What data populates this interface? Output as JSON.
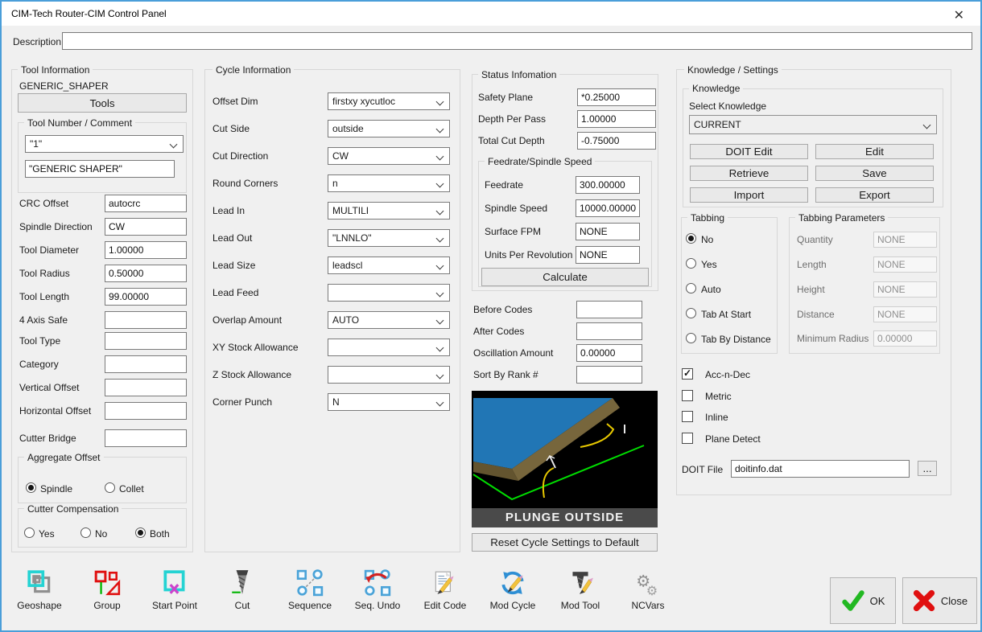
{
  "window": {
    "title": "CIM-Tech Router-CIM Control Panel",
    "close_glyph": "✕"
  },
  "description": {
    "label": "Description",
    "value": ""
  },
  "colors": {
    "accent_border": "#4a9ed9",
    "caption_bar": "#4a4a4a",
    "preview_top": "#2176b5",
    "preview_edge": "#77663c",
    "preview_outline": "#00dd00",
    "preview_path": "#e6c700",
    "ok_check": "#22b822",
    "close_x": "#e01010"
  },
  "tool": {
    "group_title": "Tool Information",
    "tool_name": "GENERIC_SHAPER",
    "tools_button": "Tools",
    "tool_number_group": "Tool Number / Comment",
    "tool_number": "\"1\"",
    "tool_comment": "\"GENERIC SHAPER\"",
    "rows": [
      {
        "label": "CRC Offset",
        "value": "autocrc"
      },
      {
        "label": "Spindle Direction",
        "value": "CW"
      },
      {
        "label": "Tool Diameter",
        "value": "1.00000"
      },
      {
        "label": "Tool Radius",
        "value": "0.50000"
      },
      {
        "label": "Tool Length",
        "value": "99.00000"
      },
      {
        "label": "4 Axis Safe",
        "value": ""
      },
      {
        "label": "Tool Type",
        "value": ""
      },
      {
        "label": "Category",
        "value": ""
      },
      {
        "label": "Vertical Offset",
        "value": ""
      },
      {
        "label": "Horizontal Offset",
        "value": ""
      },
      {
        "label": "Cutter Bridge",
        "value": ""
      }
    ],
    "aggregate_offset": {
      "title": "Aggregate Offset",
      "options": [
        {
          "label": "Spindle",
          "selected": true
        },
        {
          "label": "Collet",
          "selected": false
        }
      ]
    },
    "cutter_compensation": {
      "title": "Cutter Compensation",
      "options": [
        {
          "label": "Yes",
          "selected": false
        },
        {
          "label": "No",
          "selected": false
        },
        {
          "label": "Both",
          "selected": true
        }
      ]
    }
  },
  "cycle": {
    "group_title": "Cycle Information",
    "rows": [
      {
        "label": "Offset Dim",
        "value": "firstxy xycutloc"
      },
      {
        "label": "Cut Side",
        "value": "outside"
      },
      {
        "label": "Cut Direction",
        "value": "CW"
      },
      {
        "label": "Round Corners",
        "value": "n"
      },
      {
        "label": "Lead In",
        "value": "MULTILI"
      },
      {
        "label": "Lead Out",
        "value": "\"LNNLO\""
      },
      {
        "label": "Lead Size",
        "value": "leadscl"
      },
      {
        "label": "Lead Feed",
        "value": ""
      },
      {
        "label": "Overlap Amount",
        "value": "AUTO"
      },
      {
        "label": "XY Stock Allowance",
        "value": ""
      },
      {
        "label": "Z Stock Allowance",
        "value": ""
      },
      {
        "label": "Corner Punch",
        "value": "N"
      }
    ]
  },
  "status": {
    "group_title": "Status Infomation",
    "rows": [
      {
        "label": "Safety Plane",
        "value": "*0.25000"
      },
      {
        "label": "Depth Per Pass",
        "value": "1.00000"
      },
      {
        "label": "Total Cut Depth",
        "value": "-0.75000"
      }
    ],
    "feed": {
      "title": "Feedrate/Spindle Speed",
      "rows": [
        {
          "label": "Feedrate",
          "value": "300.00000"
        },
        {
          "label": "Spindle Speed",
          "value": "10000.00000"
        },
        {
          "label": "Surface FPM",
          "value": "NONE"
        },
        {
          "label": "Units Per Revolution",
          "value": "NONE"
        }
      ],
      "calculate_button": "Calculate"
    },
    "extra": [
      {
        "label": "Before Codes",
        "value": ""
      },
      {
        "label": "After Codes",
        "value": ""
      },
      {
        "label": "Oscillation Amount",
        "value": "0.00000"
      },
      {
        "label": "Sort By Rank #",
        "value": ""
      }
    ],
    "preview_caption": "PLUNGE OUTSIDE",
    "reset_button": "Reset Cycle Settings to Default"
  },
  "knowledge": {
    "group_title": "Knowledge / Settings",
    "inner_title": "Knowledge",
    "select_label": "Select Knowledge",
    "select_value": "CURRENT",
    "buttons": [
      "DOIT Edit",
      "Edit",
      "Retrieve",
      "Save",
      "Import",
      "Export"
    ],
    "tabbing": {
      "title": "Tabbing",
      "options": [
        {
          "label": "No",
          "selected": true
        },
        {
          "label": "Yes",
          "selected": false
        },
        {
          "label": "Auto",
          "selected": false
        },
        {
          "label": "Tab At Start",
          "selected": false
        },
        {
          "label": "Tab By Distance",
          "selected": false
        }
      ]
    },
    "tab_params": {
      "title": "Tabbing Parameters",
      "rows": [
        {
          "label": "Quantity",
          "value": "NONE"
        },
        {
          "label": "Length",
          "value": "NONE"
        },
        {
          "label": "Height",
          "value": "NONE"
        },
        {
          "label": "Distance",
          "value": "NONE"
        },
        {
          "label": "Minimum Radius",
          "value": "0.00000"
        }
      ]
    },
    "checkboxes": [
      {
        "label": "Acc-n-Dec",
        "checked": true
      },
      {
        "label": "Metric",
        "checked": false
      },
      {
        "label": "Inline",
        "checked": false
      },
      {
        "label": "Plane Detect",
        "checked": false
      }
    ],
    "doit_file": {
      "label": "DOIT File",
      "value": "doitinfo.dat",
      "browse": "..."
    }
  },
  "toolbar": {
    "items": [
      {
        "icon": "geoshape-icon",
        "label": "Geoshape"
      },
      {
        "icon": "group-icon",
        "label": "Group"
      },
      {
        "icon": "start-point-icon",
        "label": "Start Point"
      },
      {
        "icon": "cut-icon",
        "label": "Cut"
      },
      {
        "icon": "sequence-icon",
        "label": "Sequence"
      },
      {
        "icon": "seq-undo-icon",
        "label": "Seq. Undo"
      },
      {
        "icon": "edit-code-icon",
        "label": "Edit Code"
      },
      {
        "icon": "mod-cycle-icon",
        "label": "Mod Cycle"
      },
      {
        "icon": "mod-tool-icon",
        "label": "Mod Tool"
      },
      {
        "icon": "ncvars-icon",
        "label": "NCVars"
      }
    ],
    "ok_label": "OK",
    "close_label": "Close"
  }
}
